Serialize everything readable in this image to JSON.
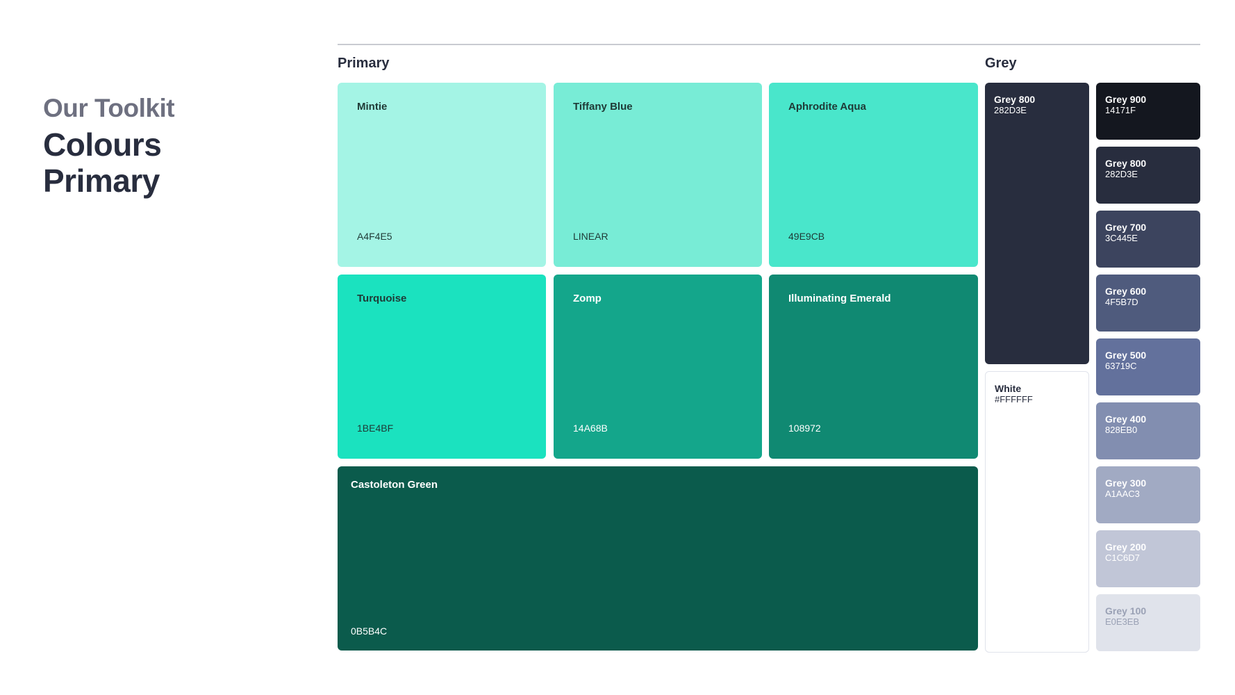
{
  "heading": {
    "line1": "Our Toolkit",
    "line2": "Colours",
    "line3": "Primary"
  },
  "sections": {
    "primary": "Primary",
    "grey": "Grey"
  },
  "primary": [
    {
      "name": "Mintie",
      "code": "A4F4E5",
      "color": "#A4F4E5"
    },
    {
      "name": "Tiffany Blue",
      "code": "LINEAR",
      "color": "#78ECD6"
    },
    {
      "name": "Aphrodite Aqua",
      "code": "49E9CB",
      "color": "#49E6CB"
    },
    {
      "name": "Turquoise",
      "code": "1BE4BF",
      "color": "#1BE2BF"
    },
    {
      "name": "Zomp",
      "code": "14A68B",
      "color": "#14A68B"
    },
    {
      "name": "Illuminating Emerald",
      "code": "108972",
      "color": "#108972"
    },
    {
      "name": "Castoleton Green",
      "code": "0B5B4C",
      "color": "#0B5B4C"
    }
  ],
  "grey_large": [
    {
      "name": "Grey 800",
      "code": "282D3E",
      "color": "#282D3E"
    },
    {
      "name": "White",
      "code": "#FFFFFF",
      "color": "#FFFFFF"
    }
  ],
  "grey": [
    {
      "name": "Grey 900",
      "code": "14171F",
      "color": "#14171F"
    },
    {
      "name": "Grey 800",
      "code": "282D3E",
      "color": "#282D3E"
    },
    {
      "name": "Grey 700",
      "code": "3C445E",
      "color": "#3C445E"
    },
    {
      "name": "Grey 600",
      "code": "4F5B7D",
      "color": "#4F5B7D"
    },
    {
      "name": "Grey 500",
      "code": "63719C",
      "color": "#63719C"
    },
    {
      "name": "Grey 400",
      "code": "828EB0",
      "color": "#828EB0"
    },
    {
      "name": "Grey 300",
      "code": "A1AAC3",
      "color": "#A1AAC3"
    },
    {
      "name": "Grey 200",
      "code": "C1C6D7",
      "color": "#C1C6D7"
    },
    {
      "name": "Grey 100",
      "code": "E0E3EB",
      "color": "#E0E3EB"
    }
  ]
}
